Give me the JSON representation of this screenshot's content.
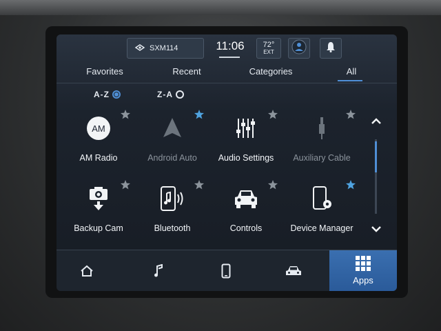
{
  "status": {
    "radio_station": "SXM114",
    "time": "11:06",
    "temperature": "72°",
    "temperature_unit": "EXT"
  },
  "tabs": [
    "Favorites",
    "Recent",
    "Categories",
    "All"
  ],
  "active_tab": "All",
  "sort": {
    "az": "A-Z",
    "za": "Z-A",
    "selected": "A-Z"
  },
  "apps": [
    {
      "label": "AM Radio",
      "icon": "am-radio-icon",
      "favorite": false,
      "enabled": true,
      "badge": "AM"
    },
    {
      "label": "Android Auto",
      "icon": "android-auto-icon",
      "favorite": true,
      "enabled": false
    },
    {
      "label": "Audio Settings",
      "icon": "audio-settings-icon",
      "favorite": false,
      "enabled": true
    },
    {
      "label": "Auxiliary Cable",
      "icon": "aux-cable-icon",
      "favorite": false,
      "enabled": false
    },
    {
      "label": "Backup Cam",
      "icon": "backup-cam-icon",
      "favorite": false,
      "enabled": true
    },
    {
      "label": "Bluetooth",
      "icon": "bluetooth-phone-icon",
      "favorite": false,
      "enabled": true
    },
    {
      "label": "Controls",
      "icon": "vehicle-controls-icon",
      "favorite": false,
      "enabled": true
    },
    {
      "label": "Device Manager",
      "icon": "device-manager-icon",
      "favorite": true,
      "enabled": true
    }
  ],
  "bottom_nav": {
    "items": [
      "home-icon",
      "music-icon",
      "phone-icon",
      "vehicle-icon",
      "apps-grid-icon"
    ],
    "apps_label": "Apps",
    "active": "Apps"
  },
  "colors": {
    "accent": "#4f8fd6",
    "star_favorite": "#4fa3e0",
    "star_default": "#8c949c",
    "active_nav": "#3a6fb0"
  }
}
